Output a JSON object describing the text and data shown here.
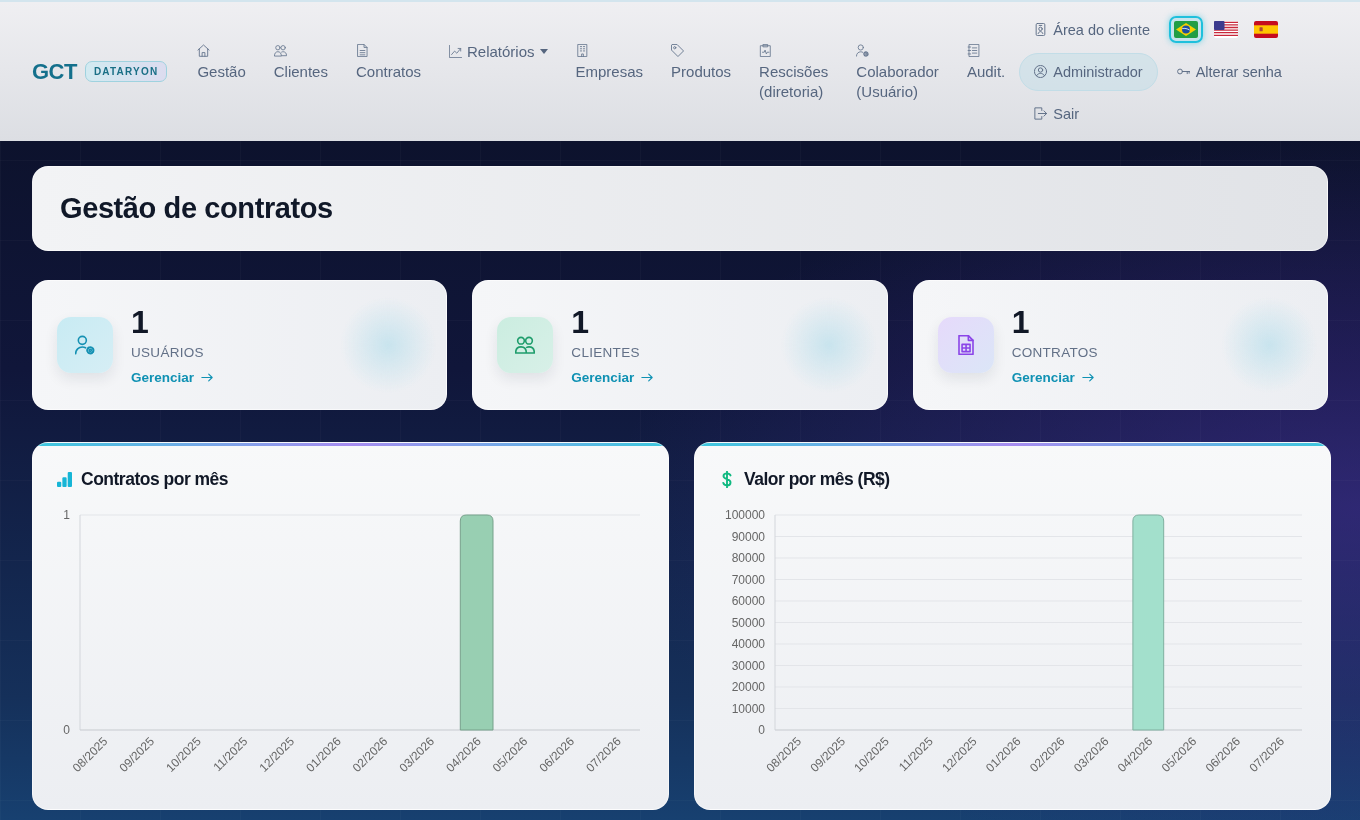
{
  "header": {
    "brand": {
      "name": "GCT",
      "badge": "DATARYON"
    },
    "nav": [
      {
        "label": "Gestão",
        "kind": "link"
      },
      {
        "label": "Clientes",
        "kind": "link"
      },
      {
        "label": "Contratos",
        "kind": "link"
      },
      {
        "label": "Relatórios",
        "kind": "dropdown"
      },
      {
        "label": "Empresas",
        "kind": "link"
      },
      {
        "label": "Produtos",
        "kind": "link"
      },
      {
        "label": "Rescisões (diretoria)",
        "kind": "link"
      },
      {
        "label": "Colaborador (Usuário)",
        "kind": "link"
      },
      {
        "label": "Audit.",
        "kind": "link"
      }
    ],
    "account": [
      {
        "kind": "link",
        "label": "Área do cliente"
      },
      {
        "kind": "languages",
        "flags": [
          {
            "selected": true
          },
          {
            "selected": false
          },
          {
            "selected": false
          }
        ]
      },
      {
        "kind": "profile",
        "label": "Administrador"
      },
      {
        "kind": "link",
        "label": "Alterar senha"
      },
      {
        "kind": "link",
        "label": "Sair"
      }
    ]
  },
  "page_title": "Gestão de contratos",
  "stats": [
    {
      "value": "1",
      "label": "USUÁRIOS",
      "link": "Gerenciar"
    },
    {
      "value": "1",
      "label": "CLIENTES",
      "link": "Gerenciar"
    },
    {
      "value": "1",
      "label": "CONTRATOS",
      "link": "Gerenciar"
    }
  ],
  "charts": [
    {
      "chart_data": {
        "type": "bar",
        "title": "Contratos por mês",
        "categories": [
          "08/2025",
          "09/2025",
          "10/2025",
          "11/2025",
          "12/2025",
          "01/2026",
          "02/2026",
          "03/2026",
          "04/2026",
          "05/2026",
          "06/2026",
          "07/2026"
        ],
        "series": [
          {
            "color": "#98cfb2",
            "values": [
              0,
              0,
              0,
              0,
              0,
              0,
              0,
              0,
              1,
              0,
              0,
              0
            ]
          }
        ],
        "ylim": [
          0,
          1
        ],
        "yticks": [
          0,
          1
        ],
        "grid": true
      }
    },
    {
      "chart_data": {
        "type": "bar",
        "title": "Valor por mês (R$)",
        "categories": [
          "08/2025",
          "09/2025",
          "10/2025",
          "11/2025",
          "12/2025",
          "01/2026",
          "02/2026",
          "03/2026",
          "04/2026",
          "05/2026",
          "06/2026",
          "07/2026"
        ],
        "series": [
          {
            "color": "#a3e0cc",
            "values": [
              0,
              0,
              0,
              0,
              0,
              0,
              0,
              0,
              100000,
              0,
              0,
              0
            ]
          }
        ],
        "ylim": [
          0,
          100000
        ],
        "yticks": [
          0,
          10000,
          20000,
          30000,
          40000,
          50000,
          60000,
          70000,
          80000,
          90000,
          100000
        ],
        "grid": true
      }
    }
  ]
}
